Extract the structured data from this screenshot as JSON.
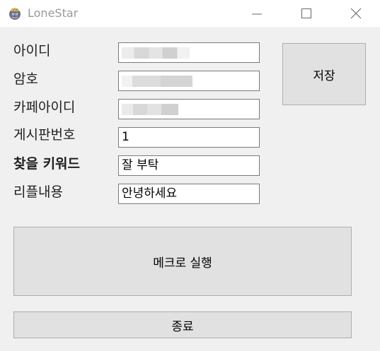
{
  "window": {
    "title": "LoneStar",
    "minimize_icon": "minimize-icon",
    "maximize_icon": "maximize-icon",
    "close_icon": "close-icon"
  },
  "form": {
    "id_label": "아이디",
    "password_label": "암호",
    "cafe_id_label": "카페아이디",
    "board_no_label": "게시판번호",
    "keyword_label": "찾을 키워드",
    "reply_label": "리플내용",
    "board_no_value": "1",
    "keyword_value": "잘 부탁",
    "reply_value": "안녕하세요"
  },
  "buttons": {
    "save_label": "저장",
    "run_macro_label": "메크로 실행",
    "exit_label": "종료"
  }
}
